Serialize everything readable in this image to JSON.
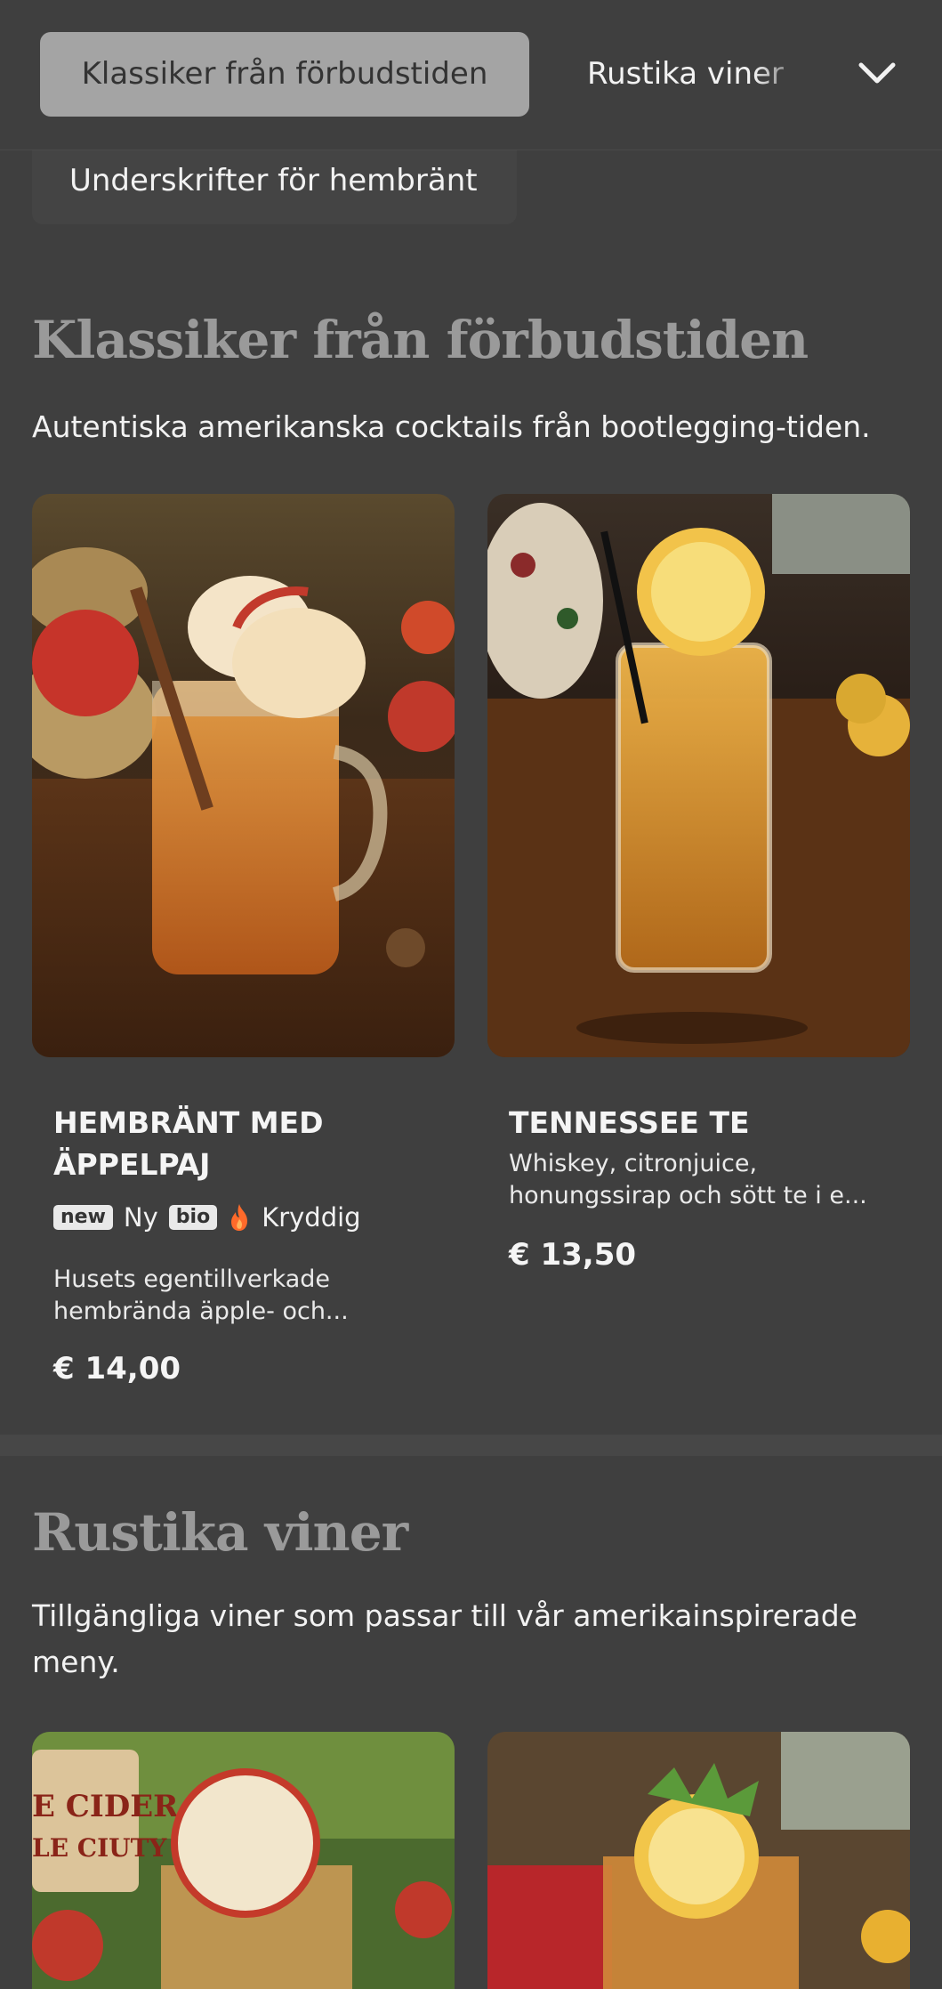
{
  "nav": {
    "active_tab": "Klassiker från förbudstiden",
    "next_tab": "Rustika viner",
    "second_tab": "Underskrifter för hembränt",
    "dropdown_icon": "chevron-down-icon"
  },
  "sections": [
    {
      "title": "Klassiker från förbudstiden",
      "description": "Autentiska amerikanska cocktails från bootlegging-tiden.",
      "items": [
        {
          "name": "HEMBRÄNT MED ÄPPELPAJ",
          "tags": [
            {
              "badge": "new",
              "label": "Ny"
            },
            {
              "badge": "bio",
              "label": ""
            },
            {
              "icon": "flame-icon",
              "label": "Kryddig"
            }
          ],
          "description": "Husets egentillverkade hembrända äpple- och...",
          "price": "€ 14,00",
          "image": "apple-cider-mason-jar"
        },
        {
          "name": "TENNESSEE TE",
          "description": "Whiskey, citronjuice, honungssirap och sött te i e...",
          "price": "€ 13,50",
          "image": "iced-tea-glass-lemon"
        }
      ]
    },
    {
      "title": "Rustika viner",
      "description": "Tillgängliga viner som passar till vår amerikainspirerade meny.",
      "items": [
        {
          "image": "cider-jar-apple",
          "sign_text": "E CIDER LE CIUTY SIDER"
        },
        {
          "image": "lemon-mint-jar"
        }
      ]
    }
  ],
  "colors": {
    "background": "#3f3f3f",
    "active_pill": "#a4a4a4",
    "section_title": "#9a9a9a",
    "flame": "#ff6a2a"
  }
}
